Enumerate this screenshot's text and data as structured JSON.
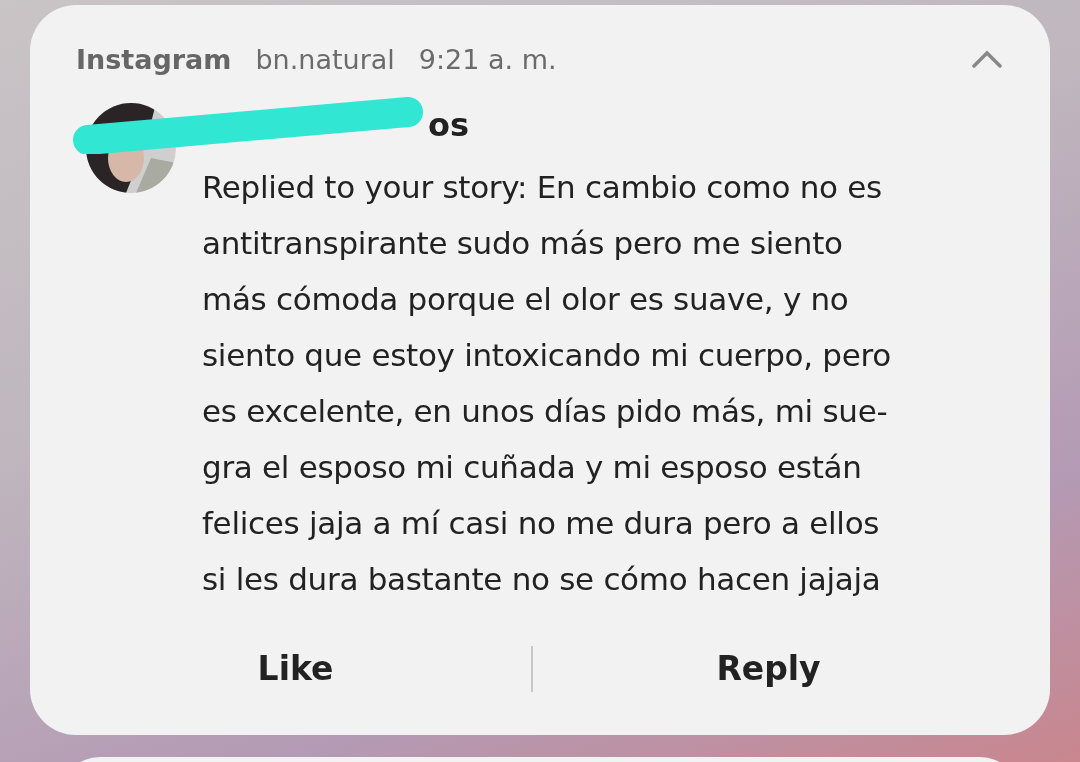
{
  "notification": {
    "app": "Instagram",
    "account": "bn.natural",
    "time": "9:21 a. m.",
    "expanded": true,
    "sender": "os",
    "message": "Replied to your story: En cambio como no es\nantitranspirante sudo más pero me siento\nmás cómoda porque el olor es suave, y no\nsiento que estoy intoxicando mi cuerpo, pero\nes excelente, en unos días pido más, mi sue-\ngra el esposo mi cuñada y mi esposo están\nfelices jaja a mí casi no me dura pero a ellos\nsi les dura bastante no se cómo hacen jajaja",
    "actions": [
      {
        "label": "Like"
      },
      {
        "label": "Reply"
      }
    ]
  }
}
